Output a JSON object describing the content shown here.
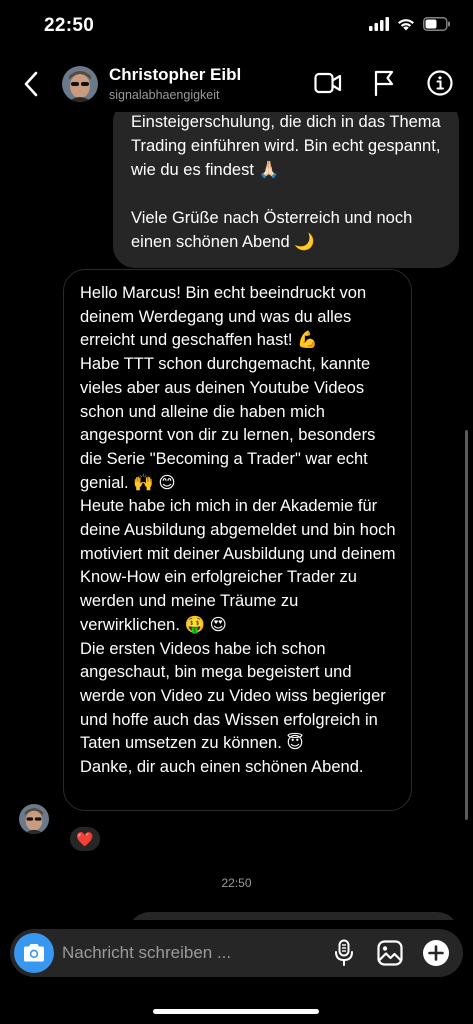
{
  "status_bar": {
    "time": "22:50"
  },
  "header": {
    "name": "Christopher Eibl",
    "username": "signalabhaengigkeit"
  },
  "messages": {
    "outgoing": {
      "lines": [
        "Einsteigerschulung, die dich in das Thema Trading einführen wird. Bin echt gespannt, wie du es findest 🙏🏻",
        "Viele Grüße nach Österreich und noch einen schönen Abend 🌙"
      ]
    },
    "incoming": {
      "lines": [
        "Hello Marcus! Bin echt beeindruckt von deinem Werdegang und was du alles erreicht und geschaffen hast! 💪",
        "Habe TTT schon durchgemacht, kannte vieles aber aus deinen Youtube Videos schon und alleine die haben mich angespornt von dir zu lernen, besonders die Serie \"Becoming a Trader\" war echt genial. 🙌 😊",
        "Heute habe ich mich in der Akademie für deine Ausbildung abgemeldet und bin hoch motiviert mit deiner Ausbildung und deinem Know-How ein erfolgreicher Trader zu werden und meine Träume zu verwirklichen. 🤑 😍",
        "Die ersten Videos habe ich schon angeschaut, bin mega begeistert und werde von Video zu Video wiss begieriger und hoffe auch das Wissen erfolgreich in Taten umsetzen zu können. 😇",
        "Danke, dir auch einen schönen Abend."
      ],
      "reaction": "❤️"
    },
    "timestamp": "22:50"
  },
  "composer": {
    "placeholder": "Nachricht schreiben ..."
  },
  "icons": {
    "back": "chevron-left-icon",
    "video_call": "video-camera-icon",
    "report": "flag-icon",
    "info": "info-icon",
    "camera": "camera-icon",
    "microphone": "microphone-icon",
    "gallery": "image-icon",
    "add": "plus-circle-icon"
  },
  "colors": {
    "background": "#000000",
    "bubble": "#262626",
    "accent": "#3897f0",
    "muted_text": "#9a9a9a"
  }
}
